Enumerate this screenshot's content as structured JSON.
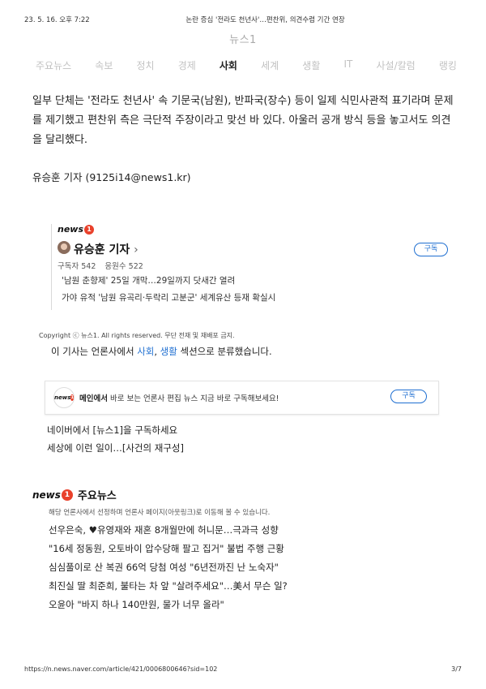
{
  "print_header": {
    "datetime": "23. 5. 16. 오후 7:22",
    "doc_title": "논란 증심 '전라도 천년사'…편찬위, 의견수렴 기간 연장"
  },
  "brand": "뉴스1",
  "nav": {
    "items": [
      "주요뉴스",
      "속보",
      "정치",
      "경제",
      "사회",
      "세계",
      "생활",
      "IT",
      "사설/칼럼",
      "랭킹"
    ],
    "active": "사회"
  },
  "article": {
    "paragraph": "일부 단체는 '전라도 천년사' 속 기문국(남원), 반파국(장수) 등이 일제 식민사관적 표기라며 문제를 제기했고 편찬위 측은 극단적 주장이라고 맞선 바 있다. 아울러 공개 방식 등을 놓고서도 의견을 달리했다.",
    "reporter_line": "유승훈 기자 (9125i14@news1.kr)"
  },
  "reporter_card": {
    "logo_word": "news",
    "logo_num": "1",
    "name": "유승훈 기자",
    "chevron": "›",
    "subscribers": "구독자 542",
    "cheers": "응원수 522",
    "subscribe_label": "구독",
    "articles": [
      "'남원 춘향제' 25일 개막…29일까지 닷새간 열려",
      "가야 유적 '남원 유곡리·두락리 고분군' 세계유산 등재 확실시"
    ]
  },
  "copyright": "Copyright ⓒ 뉴스1. All rights reserved. 무단 전재 및 재배포 금지.",
  "classification": {
    "prefix": "이 기사는 언론사에서",
    "section1": "사회",
    "sep": ",",
    "section2": "생활",
    "suffix": "섹션으로 분류했습니다."
  },
  "promo": {
    "logo_word": "news",
    "logo_num": "1",
    "bold": "메인에서",
    "text": "바로 보는 언론사 편집 뉴스 지금 바로 구독해보세요!",
    "subscribe_label": "구독"
  },
  "links": [
    "네이버에서 [뉴스1]을 구독하세요",
    "세상에 이런 일이…[사건의 재구성]"
  ],
  "main_news": {
    "logo_word": "news",
    "logo_num": "1",
    "title": "주요뉴스",
    "desc": "해당 언론사에서 선정하며 언론사 페이지(아웃링크)로 이동해 볼 수 있습니다.",
    "items": [
      "선우은숙, ♥유영재와 재혼 8개월만에 허니문…극과극 성향",
      "\"16세 정동원, 오토바이 압수당해 팔고 집거\" 불법 주행 근황",
      "심심풀이로 산 복권 66억 당첨 여성 \"6년전까진 난 노숙자\"",
      "최진실 딸 최준희, 불타는 차 앞 \"살려주세요\"…美서 무슨 일?",
      "오윤아 \"바지 하나 140만원, 물가 너무 올라\""
    ]
  },
  "print_footer": {
    "url": "https://n.news.naver.com/article/421/0006800646?sid=102",
    "page": "3/7"
  }
}
